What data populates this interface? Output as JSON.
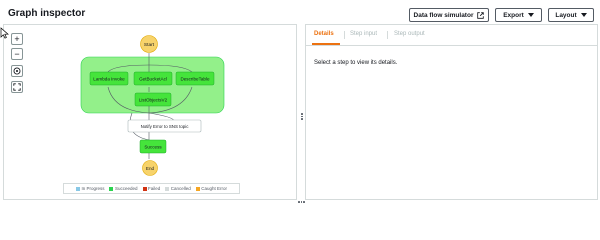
{
  "header": {
    "title": "Graph inspector",
    "buttons": {
      "simulator": "Data flow simulator",
      "export": "Export",
      "layout": "Layout"
    }
  },
  "zoom_controls": {
    "zoom_in": "+",
    "zoom_out": "−"
  },
  "graph": {
    "nodes": {
      "start": "Start",
      "lambda": "Lambda Invoke",
      "getbucket": "GetBucketAcl",
      "describe": "DescribeTable",
      "listobjects": "ListObjectsV2",
      "notify": "Notify Error to SNS topic",
      "success": "Success",
      "end": "End"
    },
    "colors": {
      "parallel_fill": "#93f08a",
      "succeeded": "#45e43b",
      "terminal": "#f7d36b",
      "edge": "#545b64"
    }
  },
  "legend": [
    {
      "label": "In Progress",
      "color": "#88c8e6"
    },
    {
      "label": "Succeeded",
      "color": "#2bd34f"
    },
    {
      "label": "Failed",
      "color": "#d13212"
    },
    {
      "label": "Cancelled",
      "color": "#d5dbdb"
    },
    {
      "label": "Caught Error",
      "color": "#f5a623"
    }
  ],
  "details": {
    "tabs": [
      "Details",
      "Step input",
      "Step output"
    ],
    "active_tab": "Details",
    "hint": "Select a step to view its details."
  }
}
